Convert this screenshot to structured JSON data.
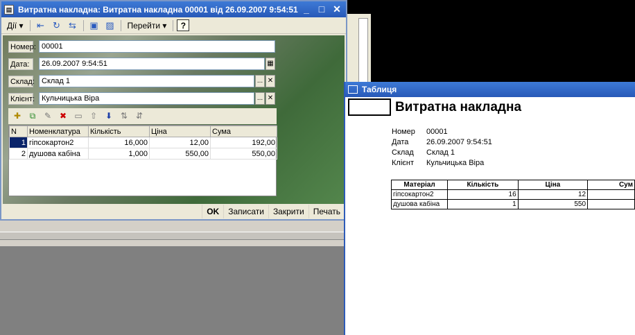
{
  "main": {
    "title": "Витратна накладна: Витратна накладна 00001 від 26.09.2007 9:54:51",
    "toolbar": {
      "actions_label": "Дії",
      "goto_label": "Перейти",
      "help_label": "?"
    },
    "fields": {
      "number_label": "Номер:",
      "number_value": "00001",
      "date_label": "Дата:",
      "date_value": "26.09.2007  9:54:51",
      "warehouse_label": "Склад:",
      "warehouse_value": "Склад 1",
      "client_label": "Клієнт:",
      "client_value": "Кульчицька Віра",
      "select_btn": "...",
      "clear_btn": "✕"
    },
    "grid": {
      "columns": [
        "N",
        "Номенклатура",
        "Кількість",
        "Ціна",
        "Сума"
      ],
      "rows": [
        [
          "1",
          "гіпсокартон2",
          "16,000",
          "12,00",
          "192,00"
        ],
        [
          "2",
          "душова кабіна",
          "1,000",
          "550,00",
          "550,00"
        ]
      ]
    },
    "buttons": {
      "ok": "OK",
      "save": "Записати",
      "close": "Закрити",
      "print": "Печать"
    }
  },
  "table_window": {
    "title": "Таблиця",
    "heading": "Витратна накладна",
    "info": [
      {
        "key": "Номер",
        "value": "00001"
      },
      {
        "key": "Дата",
        "value": "26.09.2007 9:54:51"
      },
      {
        "key": "Склад",
        "value": "Склад 1"
      },
      {
        "key": "Клієнт",
        "value": "Кульчицька Віра"
      }
    ],
    "table": {
      "headers": [
        "Матеріал",
        "Кількість",
        "Ціна",
        "Сум"
      ],
      "rows": [
        [
          "гіпсокартон2",
          "16",
          "12",
          ""
        ],
        [
          "душова кабіна",
          "1",
          "550",
          ""
        ]
      ]
    }
  }
}
